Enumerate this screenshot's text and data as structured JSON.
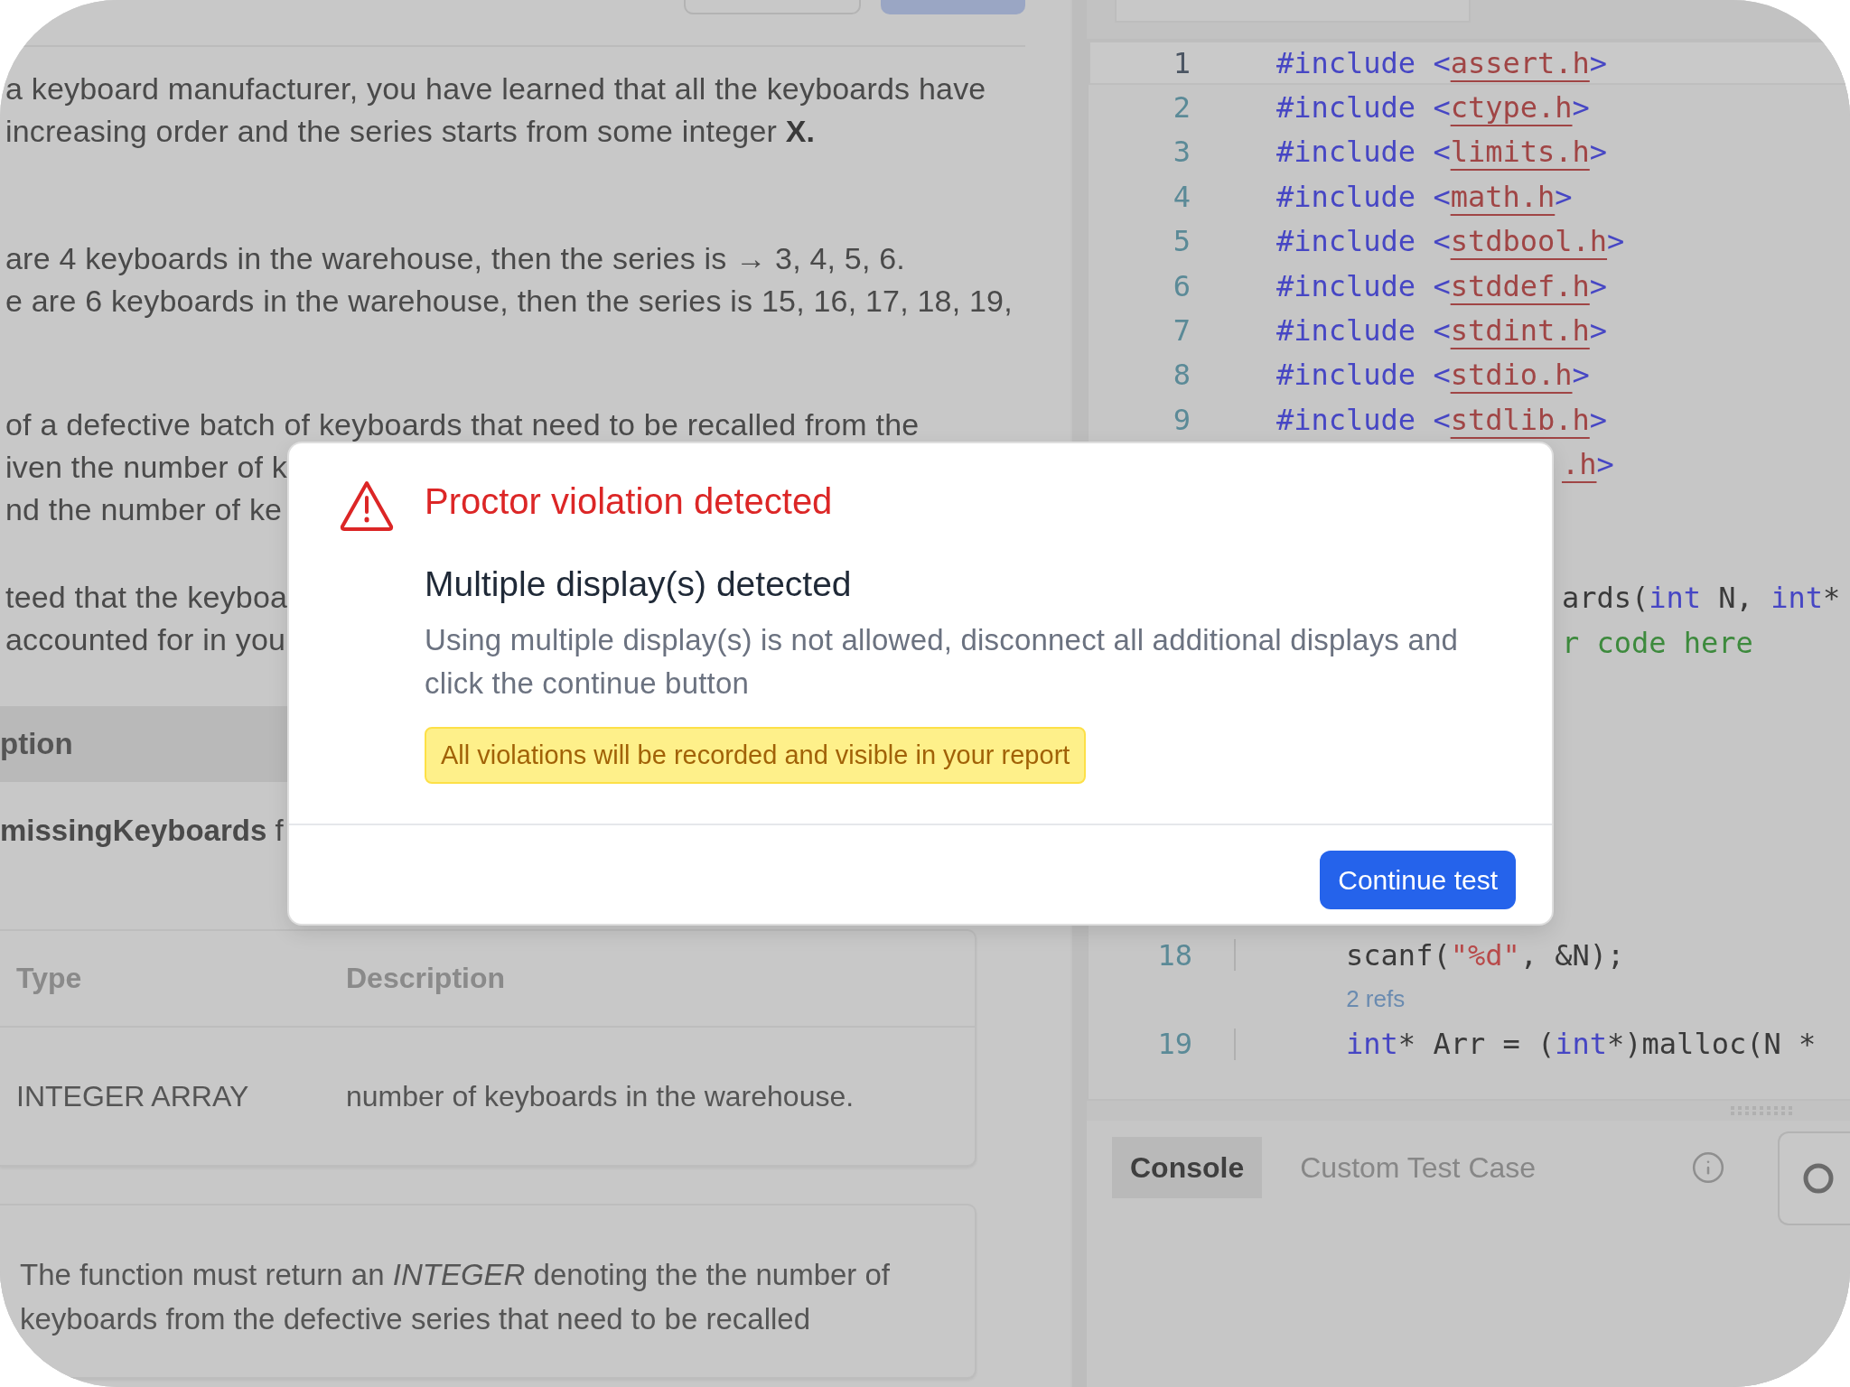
{
  "problem": {
    "paragraphs": [
      {
        "lines": [
          "a keyboard manufacturer, you have learned that all the keyboards have",
          "increasing order and the series starts from some integer **X.**"
        ]
      },
      {
        "lines": [
          "are 4 keyboards in the warehouse, then the series is → 3, 4, 5, 6.",
          "e are 6 keyboards in the warehouse, then the series is 15, 16, 17, 18, 19,"
        ]
      },
      {
        "lines": [
          "of a defective batch of keyboards that need to be recalled from the",
          "iven the number of k",
          "nd the number of ke"
        ]
      },
      {
        "lines": [
          "teed that the keyboa",
          "accounted for in you"
        ]
      }
    ],
    "section_header": "ption",
    "signature_text": "**missingKeyboards** f",
    "parameters": {
      "columns": [
        "Type",
        "Description"
      ],
      "rows": [
        [
          "INTEGER ARRAY",
          "number of keyboards in the warehouse."
        ]
      ]
    },
    "return_text": "The function must return an *INTEGER* denoting the the number of keyboards from the defective series that need to be recalled"
  },
  "editor": {
    "lines": [
      {
        "number": "1",
        "current": true,
        "tokens": [
          {
            "kind": "keyword",
            "text": "#include"
          },
          {
            "kind": "keyword",
            "text": " <"
          },
          {
            "kind": "header",
            "text": "assert.h"
          },
          {
            "kind": "keyword",
            "text": ">"
          }
        ]
      },
      {
        "number": "2",
        "current": false,
        "tokens": [
          {
            "kind": "keyword",
            "text": "#include"
          },
          {
            "kind": "keyword",
            "text": " <"
          },
          {
            "kind": "header",
            "text": "ctype.h"
          },
          {
            "kind": "keyword",
            "text": ">"
          }
        ]
      },
      {
        "number": "3",
        "current": false,
        "tokens": [
          {
            "kind": "keyword",
            "text": "#include"
          },
          {
            "kind": "keyword",
            "text": " <"
          },
          {
            "kind": "header",
            "text": "limits.h"
          },
          {
            "kind": "keyword",
            "text": ">"
          }
        ]
      },
      {
        "number": "4",
        "current": false,
        "tokens": [
          {
            "kind": "keyword",
            "text": "#include"
          },
          {
            "kind": "keyword",
            "text": " <"
          },
          {
            "kind": "header",
            "text": "math.h"
          },
          {
            "kind": "keyword",
            "text": ">"
          }
        ]
      },
      {
        "number": "5",
        "current": false,
        "tokens": [
          {
            "kind": "keyword",
            "text": "#include"
          },
          {
            "kind": "keyword",
            "text": " <"
          },
          {
            "kind": "header",
            "text": "stdbool.h"
          },
          {
            "kind": "keyword",
            "text": ">"
          }
        ]
      },
      {
        "number": "6",
        "current": false,
        "tokens": [
          {
            "kind": "keyword",
            "text": "#include"
          },
          {
            "kind": "keyword",
            "text": " <"
          },
          {
            "kind": "header",
            "text": "stddef.h"
          },
          {
            "kind": "keyword",
            "text": ">"
          }
        ]
      },
      {
        "number": "7",
        "current": false,
        "tokens": [
          {
            "kind": "keyword",
            "text": "#include"
          },
          {
            "kind": "keyword",
            "text": " <"
          },
          {
            "kind": "header",
            "text": "stdint.h"
          },
          {
            "kind": "keyword",
            "text": ">"
          }
        ]
      },
      {
        "number": "8",
        "current": false,
        "tokens": [
          {
            "kind": "keyword",
            "text": "#include"
          },
          {
            "kind": "keyword",
            "text": " <"
          },
          {
            "kind": "header",
            "text": "stdio.h"
          },
          {
            "kind": "keyword",
            "text": ">"
          }
        ]
      },
      {
        "number": "9",
        "current": false,
        "tokens": [
          {
            "kind": "keyword",
            "text": "#include"
          },
          {
            "kind": "keyword",
            "text": " <"
          },
          {
            "kind": "header",
            "text": "stdlib.h"
          },
          {
            "kind": "keyword",
            "text": ">"
          }
        ]
      }
    ],
    "partial_lines": [
      {
        "tokens": [
          {
            "kind": "header",
            "text": ".h"
          },
          {
            "kind": "keyword",
            "text": ">"
          }
        ]
      },
      {
        "tokens": [
          {
            "kind": "plain",
            "text": "ards("
          },
          {
            "kind": "keyword",
            "text": "int"
          },
          {
            "kind": "plain",
            "text": " N, "
          },
          {
            "kind": "keyword",
            "text": "int"
          },
          {
            "kind": "plain",
            "text": "*"
          }
        ]
      },
      {
        "tokens": [
          {
            "kind": "comment",
            "text": "r code here"
          }
        ]
      }
    ],
    "lower_lines": [
      {
        "kind": "code",
        "number": "18",
        "tokens": [
          {
            "kind": "plain",
            "text": "scanf("
          },
          {
            "kind": "string",
            "text": "\"%d\""
          },
          {
            "kind": "plain",
            "text": ", &N);"
          }
        ]
      },
      {
        "kind": "codelens",
        "text": "2 refs"
      },
      {
        "kind": "code",
        "number": "19",
        "tokens": [
          {
            "kind": "keyword",
            "text": "int"
          },
          {
            "kind": "plain",
            "text": "* Arr = ("
          },
          {
            "kind": "keyword",
            "text": "int"
          },
          {
            "kind": "plain",
            "text": "*)malloc(N *"
          }
        ]
      }
    ]
  },
  "console": {
    "tabs": [
      {
        "label": "Console",
        "selected": true
      },
      {
        "label": "Custom Test Case",
        "selected": false
      }
    ]
  },
  "dialog": {
    "title": "Proctor violation detected",
    "heading": "Multiple display(s) detected",
    "message": "Using multiple display(s) is not allowed, disconnect all additional displays and click the continue button",
    "notice": "All violations will be recorded and visible in your report",
    "button": "Continue test"
  }
}
